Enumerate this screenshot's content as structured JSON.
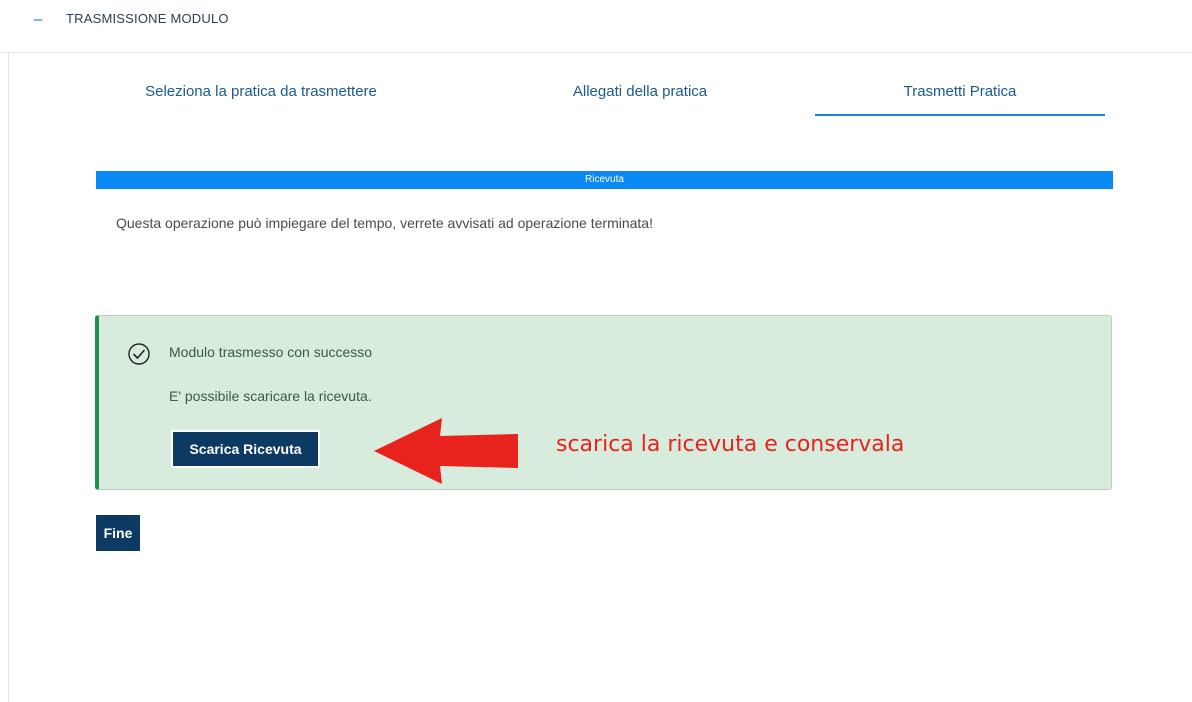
{
  "header": {
    "collapse_icon": "minus-icon",
    "title": "TRASMISSIONE MODULO"
  },
  "tabs": [
    {
      "label": "Seleziona la pratica da trasmettere",
      "active": false
    },
    {
      "label": "Allegati della pratica",
      "active": false
    },
    {
      "label": "Trasmetti Pratica",
      "active": true
    }
  ],
  "progress": {
    "label": "Ricevuta",
    "percent": 100
  },
  "notice": "Questa operazione può impiegare del tempo, verrete avvisati ad operazione terminata!",
  "alert": {
    "icon": "check-circle-icon",
    "title": "Modulo trasmesso con successo",
    "text": "E' possibile scaricare la ricevuta.",
    "button_label": "Scarica Ricevuta"
  },
  "annotation": {
    "text": "scarica la ricevuta e conservala",
    "icon": "arrow-left-icon"
  },
  "footer": {
    "fine_label": "Fine"
  },
  "colors": {
    "primary": "#0d3a63",
    "progress": "#0b8af5",
    "success_bg": "#d7ecdc",
    "success_border": "#1e8f4e",
    "annotation": "#e8231e"
  }
}
